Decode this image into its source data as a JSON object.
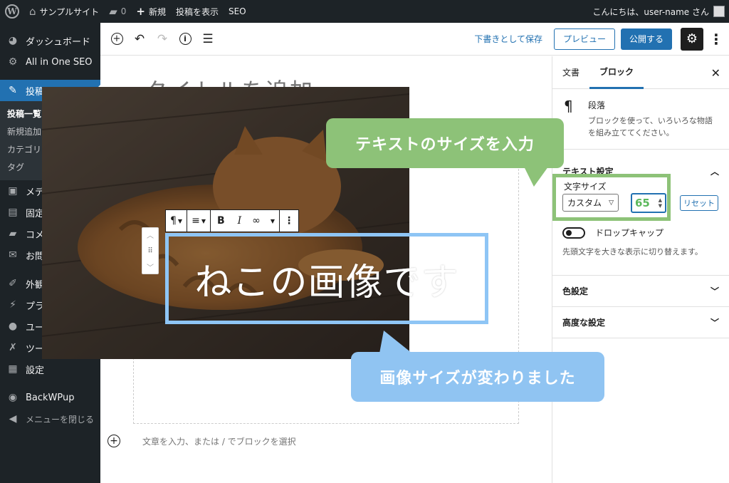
{
  "adminbar": {
    "site_name": "サンプルサイト",
    "comments_count": "0",
    "new_label": "新規",
    "view_post": "投稿を表示",
    "seo": "SEO",
    "greeting": "こんにちは、user-name さん"
  },
  "sidebar": {
    "items": [
      {
        "label": "ダッシュボード",
        "icon": "dashboard-icon"
      },
      {
        "label": "All in One SEO",
        "icon": "gear-icon"
      },
      {
        "label": "投稿",
        "icon": "pin-icon"
      },
      {
        "label": "メディア",
        "icon": "media-icon"
      },
      {
        "label": "固定ページ",
        "icon": "page-icon"
      },
      {
        "label": "コメント",
        "icon": "comment-icon"
      },
      {
        "label": "お問い合わせ",
        "icon": "mail-icon"
      },
      {
        "label": "外観",
        "icon": "brush-icon"
      },
      {
        "label": "プラグイン",
        "icon": "plugin-icon"
      },
      {
        "label": "ユーザー",
        "icon": "user-icon"
      },
      {
        "label": "ツール",
        "icon": "wrench-icon"
      },
      {
        "label": "設定",
        "icon": "settings-icon"
      },
      {
        "label": "BackWPup",
        "icon": "backwpup-icon"
      },
      {
        "label": "メニューを閉じる",
        "icon": "collapse-icon"
      }
    ],
    "submenu": [
      "投稿一覧",
      "新規追加",
      "カテゴリー",
      "タグ"
    ]
  },
  "header": {
    "save_draft": "下書きとして保存",
    "preview": "プレビュー",
    "publish": "公開する"
  },
  "editor": {
    "title_placeholder": "タイトルを追加",
    "cover_text": "ねこの画像です",
    "appender_placeholder": "文章を入力、または / でブロックを選択"
  },
  "inspector": {
    "tab_document": "文書",
    "tab_block": "ブロック",
    "block_name": "段落",
    "block_desc_1": "ブロックを使って、いろいろな物語",
    "block_desc_2": "を組み立ててください。",
    "text_settings": "テキスト設定",
    "font_size_label": "文字サイズ",
    "font_size_select": "カスタム",
    "font_size_value": "65",
    "reset": "リセット",
    "drop_cap": "ドロップキャップ",
    "drop_cap_help": "先頭文字を大きな表示に切り替えます。",
    "color_settings": "色設定",
    "advanced": "高度な設定"
  },
  "annotations": {
    "green": "テキストのサイズを入力",
    "blue": "画像サイズが変わりました"
  },
  "colors": {
    "accent": "#2271b1",
    "admin_dark": "#1d2327",
    "callout_green": "#8dc278",
    "callout_blue": "#90c4f2"
  }
}
